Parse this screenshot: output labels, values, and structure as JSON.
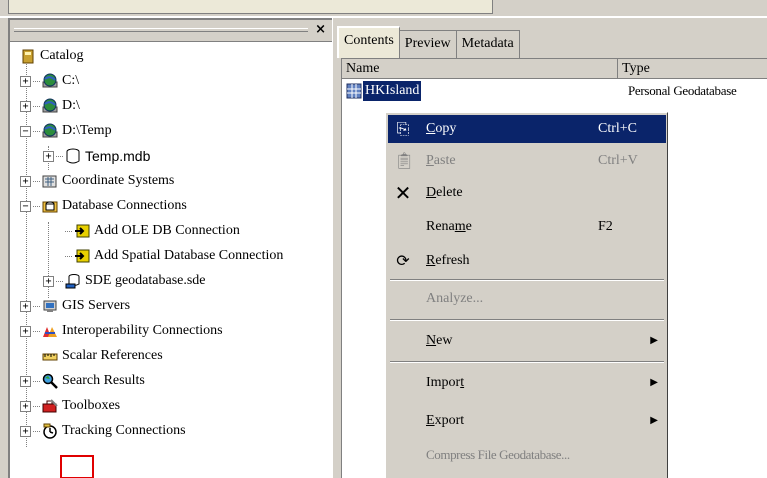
{
  "left_panel": {
    "close_label": "×",
    "tree": [
      {
        "label": "Catalog",
        "icon": "catalog-icon",
        "expand": ""
      },
      {
        "label": "C:\\",
        "icon": "drive-icon",
        "expand": "+"
      },
      {
        "label": "D:\\",
        "icon": "drive-icon",
        "expand": "+"
      },
      {
        "label": "D:\\Temp",
        "icon": "folder-icon",
        "expand": "−"
      },
      {
        "label": "Temp.mdb",
        "icon": "database-icon",
        "expand": "+"
      },
      {
        "label": "Coordinate Systems",
        "icon": "coordinate-systems-icon",
        "expand": "+"
      },
      {
        "label": "Database Connections",
        "icon": "database-connections-icon",
        "expand": "−"
      },
      {
        "label": "Add OLE DB Connection",
        "icon": "add-connection-icon",
        "expand": ""
      },
      {
        "label": "Add Spatial Database Connection",
        "icon": "add-connection-icon",
        "expand": ""
      },
      {
        "label": "SDE geodatabase.sde",
        "icon": "sde-icon",
        "expand": "+"
      },
      {
        "label": "GIS Servers",
        "icon": "gis-servers-icon",
        "expand": "+"
      },
      {
        "label": "Interoperability Connections",
        "icon": "interop-icon",
        "expand": "+"
      },
      {
        "label": "Scalar References",
        "icon": "scalar-icon",
        "expand": ""
      },
      {
        "label": "Search Results",
        "icon": "search-results-icon",
        "expand": "+"
      },
      {
        "label": "Toolboxes",
        "icon": "toolbox-icon",
        "expand": "+"
      },
      {
        "label": "Tracking Connections",
        "icon": "tracking-icon",
        "expand": "+"
      }
    ]
  },
  "right_panel": {
    "tabs": [
      {
        "label": "Contents"
      },
      {
        "label": "Preview"
      },
      {
        "label": "Metadata"
      }
    ],
    "columns": {
      "name": "Name",
      "type": "Type"
    },
    "row": {
      "name": "HKIsland",
      "type": "Personal Geodatabase"
    }
  },
  "context_menu": {
    "copy": {
      "pre": "",
      "ul": "C",
      "post": "opy",
      "shortcut": "Ctrl+C"
    },
    "paste": {
      "pre": "",
      "ul": "P",
      "post": "aste",
      "shortcut": "Ctrl+V"
    },
    "delete": {
      "pre": "",
      "ul": "D",
      "post": "elete"
    },
    "rename": {
      "pre": "Rena",
      "ul": "m",
      "post": "e",
      "shortcut": "F2"
    },
    "refresh": {
      "pre": "",
      "ul": "R",
      "post": "efresh"
    },
    "analyze": {
      "label": "Analyze..."
    },
    "new": {
      "pre": "",
      "ul": "N",
      "post": "ew"
    },
    "import": {
      "pre": "Impor",
      "ul": "t",
      "post": ""
    },
    "export": {
      "pre": "",
      "ul": "E",
      "post": "xport"
    },
    "compress": {
      "label": "Compress File Geodatabase..."
    }
  },
  "colors": {
    "selection": "#0a246a",
    "highlight_box": "#e00000",
    "face": "#d4d0c8"
  }
}
